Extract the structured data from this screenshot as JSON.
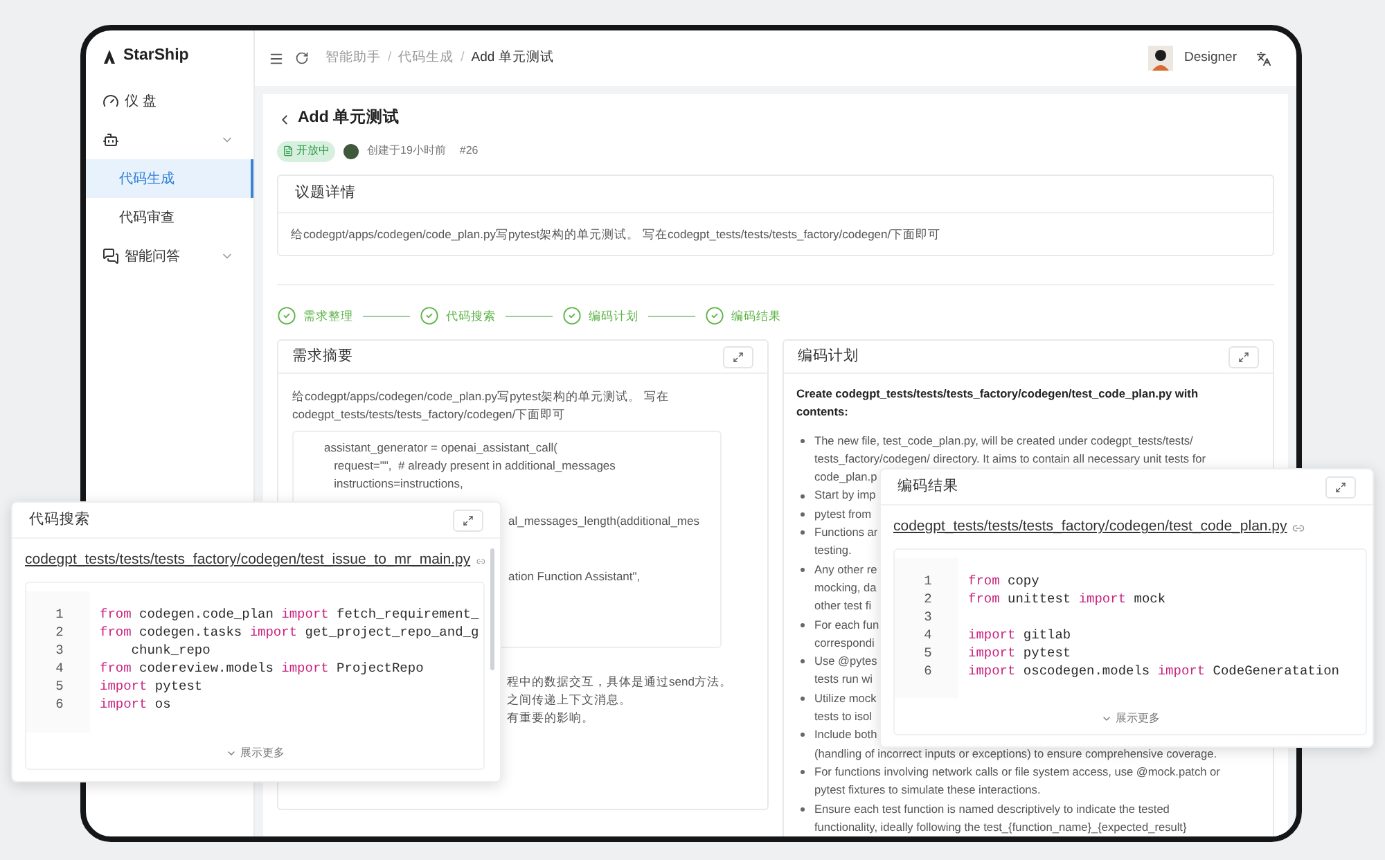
{
  "sidebar": {
    "logo": "StarShip",
    "items": [
      {
        "kind": "link",
        "label": "仪 盘",
        "selected": false
      },
      {
        "kind": "group",
        "children": [
          {
            "label": "代码生成",
            "selected": true
          },
          {
            "label": "代码审查",
            "selected": false
          }
        ]
      },
      {
        "kind": "group",
        "label": "智能问答"
      }
    ]
  },
  "header": {
    "breadcrumb": [
      "智能助手",
      "代码生成",
      "Add 单元测试"
    ],
    "separator": "/",
    "user": "Designer"
  },
  "issue": {
    "title": "Add 单元测试",
    "status": "开放中",
    "created": "创建于19小时前",
    "number": "#26",
    "details_title": "议题详情",
    "details_text": "给codegpt/apps/codegen/code_plan.py写pytest架构的单元测试。 写在codegpt_tests/tests/tests_factory/codegen/下面即可"
  },
  "steps": [
    {
      "label": "需求整理",
      "done": true
    },
    {
      "label": "代码搜索",
      "done": true
    },
    {
      "label": "编码计划",
      "done": true
    },
    {
      "label": "编码结果",
      "done": true
    }
  ],
  "summary_panel": {
    "title": "需求摘要",
    "text": [
      "给codegpt/apps/codegen/code_plan.py写pytest架构的单元测试。 写在",
      "codegpt_tests/tests/tests_factory/codegen/下面即可"
    ],
    "code_lines": [
      {
        "kind": "line",
        "text": "assistant_generator = openai_assistant_call("
      },
      {
        "kind": "line",
        "text": "   request=\"\",  # already present in additional_messages"
      },
      {
        "kind": "line",
        "text": "   instructions=instructions,"
      },
      {
        "kind": "hidden"
      },
      {
        "kind": "fragment",
        "text": "al_messages_length(additional_mes"
      },
      {
        "kind": "hidden"
      },
      {
        "kind": "hidden"
      },
      {
        "kind": "fragment",
        "text": "ation Function Assistant\","
      }
    ],
    "after_text": [
      "程中的数据交互，具体是通过send方法。",
      "之间传递上下文消息。",
      "有重要的影响。"
    ]
  },
  "plan_panel": {
    "title": "编码计划",
    "intro": [
      "Create codegpt_tests/tests/tests_factory/codegen/test_code_plan.py with",
      "contents:"
    ],
    "bullets": [
      [
        "The new file, test_code_plan.py, will be created under codegpt_tests/tests/",
        "tests_factory/codegen/ directory. It aims to contain all necessary unit tests for",
        "code_plan.p"
      ],
      [
        "Start by imp"
      ],
      [
        "pytest from"
      ],
      [
        "Functions ar",
        "testing."
      ],
      [
        "Any other re",
        "mocking, da",
        "other test fi"
      ],
      [
        "For each fun",
        "correspondi"
      ],
      [
        "Use @pytes",
        "tests run wi"
      ],
      [
        "Utilize mock",
        "tests to isol"
      ],
      [
        "Include both",
        "(handling of incorrect inputs or exceptions) to ensure comprehensive coverage."
      ],
      [
        "For functions involving network calls or file system access, use @mock.patch or",
        "pytest fixtures to simulate these interactions."
      ],
      [
        "Ensure each test function is named descriptively to indicate the tested",
        "functionality, ideally following the test_{function_name}_{expected_result}"
      ]
    ]
  },
  "search_popup": {
    "title": "代码搜索",
    "path": "codegpt_tests/tests/tests_factory/codegen/test_issue_to_mr_main.py",
    "more": "展示更多",
    "lines": [
      {
        "n": "1",
        "tokens": [
          {
            "kind": "keyword",
            "text": "from"
          },
          {
            "kind": "plain",
            "text": " codegen.code_plan "
          },
          {
            "kind": "keyword",
            "text": "import"
          },
          {
            "kind": "plain",
            "text": " fetch_requirement_"
          }
        ]
      },
      {
        "n": "2",
        "tokens": [
          {
            "kind": "keyword",
            "text": "from"
          },
          {
            "kind": "plain",
            "text": " codegen.tasks "
          },
          {
            "kind": "keyword",
            "text": "import"
          },
          {
            "kind": "plain",
            "text": " get_project_repo_and_g"
          }
        ]
      },
      {
        "n": "3",
        "tokens": [
          {
            "kind": "plain",
            "text": "    chunk_repo"
          }
        ]
      },
      {
        "n": "4",
        "tokens": [
          {
            "kind": "keyword",
            "text": "from"
          },
          {
            "kind": "plain",
            "text": " codereview.models "
          },
          {
            "kind": "keyword",
            "text": "import"
          },
          {
            "kind": "plain",
            "text": " ProjectRepo"
          }
        ]
      },
      {
        "n": "5",
        "tokens": [
          {
            "kind": "keyword",
            "text": "import"
          },
          {
            "kind": "plain",
            "text": " pytest"
          }
        ]
      },
      {
        "n": "6",
        "tokens": [
          {
            "kind": "keyword",
            "text": "import"
          },
          {
            "kind": "plain",
            "text": " os"
          }
        ]
      }
    ]
  },
  "result_popup": {
    "title": "编码结果",
    "path": "codegpt_tests/tests/tests_factory/codegen/test_code_plan.py",
    "more": "展示更多",
    "lines": [
      {
        "n": "1",
        "tokens": [
          {
            "kind": "keyword",
            "text": "from"
          },
          {
            "kind": "plain",
            "text": " copy"
          }
        ]
      },
      {
        "n": "2",
        "tokens": [
          {
            "kind": "keyword",
            "text": "from"
          },
          {
            "kind": "plain",
            "text": " unittest "
          },
          {
            "kind": "keyword",
            "text": "import"
          },
          {
            "kind": "plain",
            "text": " mock"
          }
        ]
      },
      {
        "n": "3"
      },
      {
        "n": "4",
        "tokens": [
          {
            "kind": "keyword",
            "text": "import"
          },
          {
            "kind": "plain",
            "text": " gitlab"
          }
        ]
      },
      {
        "n": "5",
        "tokens": [
          {
            "kind": "keyword",
            "text": "import"
          },
          {
            "kind": "plain",
            "text": " pytest"
          }
        ]
      },
      {
        "n": "6",
        "tokens": [
          {
            "kind": "keyword",
            "text": "import"
          },
          {
            "kind": "plain",
            "text": " oscodegen.models "
          },
          {
            "kind": "keyword",
            "text": "import"
          },
          {
            "kind": "plain",
            "text": " CodeGeneratation"
          }
        ]
      }
    ]
  }
}
